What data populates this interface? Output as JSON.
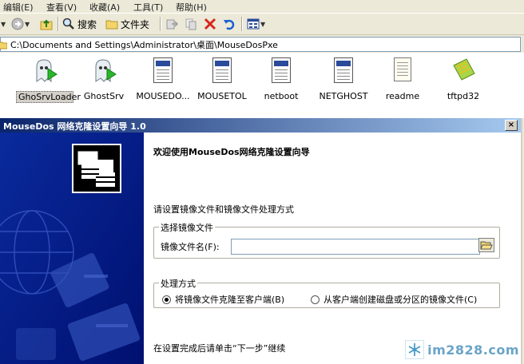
{
  "menubar": {
    "items": [
      {
        "label": "编辑(E)"
      },
      {
        "label": "查看(V)"
      },
      {
        "label": "收藏(A)"
      },
      {
        "label": "工具(T)"
      },
      {
        "label": "帮助(H)"
      }
    ]
  },
  "toolbar": {
    "search_label": "搜索",
    "folders_label": "文件夹"
  },
  "address": {
    "path": "C:\\Documents and Settings\\Administrator\\桌面\\MouseDosPxe"
  },
  "files": [
    {
      "name": "GhoSrvLoader",
      "icon": "ghost-server-icon",
      "selected": true
    },
    {
      "name": "GhostSrv",
      "icon": "ghost-server-icon"
    },
    {
      "name": "MOUSEDO...",
      "icon": "program-window-icon"
    },
    {
      "name": "MOUSETOL",
      "icon": "program-window-icon"
    },
    {
      "name": "netboot",
      "icon": "program-window-icon"
    },
    {
      "name": "NETGHOST",
      "icon": "program-window-icon"
    },
    {
      "name": "readme",
      "icon": "text-document-icon"
    },
    {
      "name": "tftpd32",
      "icon": "network-card-icon"
    }
  ],
  "wizard": {
    "title": "MouseDos 网络克隆设置向导 1.0",
    "close_label": "×",
    "heading": "欢迎使用MouseDos网络克隆设置向导",
    "prompt": "请设置镜像文件和镜像文件处理方式",
    "image_group": {
      "legend": "选择镜像文件",
      "field_label": "镜像文件名(F):",
      "value": ""
    },
    "mode_group": {
      "legend": "处理方式",
      "options": [
        {
          "label": "将镜像文件克隆至客户端(B)",
          "selected": true
        },
        {
          "label": "从客户端创建磁盘或分区的镜像文件(C)",
          "selected": false
        }
      ]
    },
    "footer": "在设置完成后请单击“下一步”继续"
  },
  "watermark": {
    "text": "im2828.com"
  },
  "colors": {
    "titlebar_start": "#0a246a",
    "titlebar_end": "#a6caf0",
    "side_panel": "#001a8a",
    "chrome": "#ece9d8"
  }
}
